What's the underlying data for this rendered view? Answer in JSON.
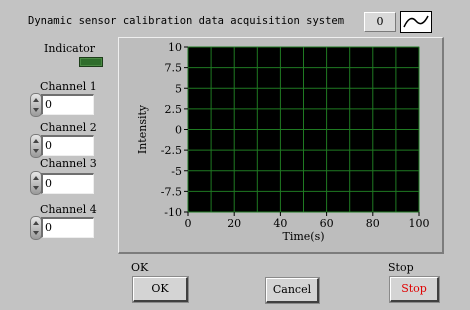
{
  "title": "Dynamic sensor calibration data acquisition system",
  "plot_legend": {
    "number": "0",
    "icon": "sine-wave-icon"
  },
  "indicator": {
    "label": "Indicator",
    "color": "#2f6d2c"
  },
  "channels": [
    {
      "label": "Channel 1",
      "value": "0"
    },
    {
      "label": "Channel 2",
      "value": "0"
    },
    {
      "label": "Channel 3",
      "value": "0"
    },
    {
      "label": "Channel 4",
      "value": "0"
    }
  ],
  "graph": {
    "xlabel": "Time(s)",
    "ylabel": "Intensity",
    "plot_bg": "#000000",
    "grid_color": "#1f7a22"
  },
  "chart_data": {
    "type": "line",
    "title": "",
    "xlabel": "Time(s)",
    "ylabel": "Intensity",
    "xlim": [
      0,
      100
    ],
    "ylim": [
      -10,
      10
    ],
    "x_ticks": [
      "0",
      "20",
      "40",
      "60",
      "80",
      "100"
    ],
    "y_ticks": [
      "10",
      "7.5",
      "5",
      "2.5",
      "0",
      "-2.5",
      "-5",
      "-7.5",
      "-10"
    ],
    "grid": true,
    "series": []
  },
  "buttons": {
    "ok_caption": "OK",
    "ok_label": "OK",
    "cancel_label": "Cancel",
    "stop_caption": "Stop",
    "stop_label": "Stop",
    "stop_color": "#e00000"
  }
}
